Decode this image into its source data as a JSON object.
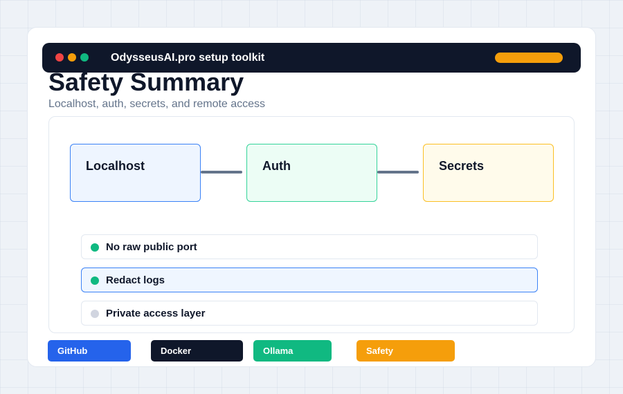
{
  "app": {
    "title": "OdysseusAI.pro setup toolkit",
    "accent_color": "#f59e0b",
    "window_controls": [
      "close",
      "minimize",
      "maximize"
    ]
  },
  "page": {
    "title": "Safety Summary",
    "subtitle": "Localhost, auth, secrets, and remote access"
  },
  "flow": {
    "nodes": [
      {
        "label": "Localhost",
        "color": "#3b82f6"
      },
      {
        "label": "Auth",
        "color": "#34d399"
      },
      {
        "label": "Secrets",
        "color": "#fbbf24"
      }
    ]
  },
  "checklist": {
    "items": [
      {
        "label": "No raw public port",
        "done": true,
        "status_color": "#10b981"
      },
      {
        "label": "Redact logs",
        "done": true,
        "selected": true,
        "status_color": "#10b981"
      },
      {
        "label": "Private access layer",
        "done": false,
        "status_color": "#d1d5e0"
      }
    ]
  },
  "tags": [
    {
      "label": "GitHub",
      "color": "#2563eb"
    },
    {
      "label": "Docker",
      "color": "#0f172a"
    },
    {
      "label": "Ollama",
      "color": "#10b981"
    },
    {
      "label": "Safety",
      "color": "#f59e0b"
    }
  ]
}
